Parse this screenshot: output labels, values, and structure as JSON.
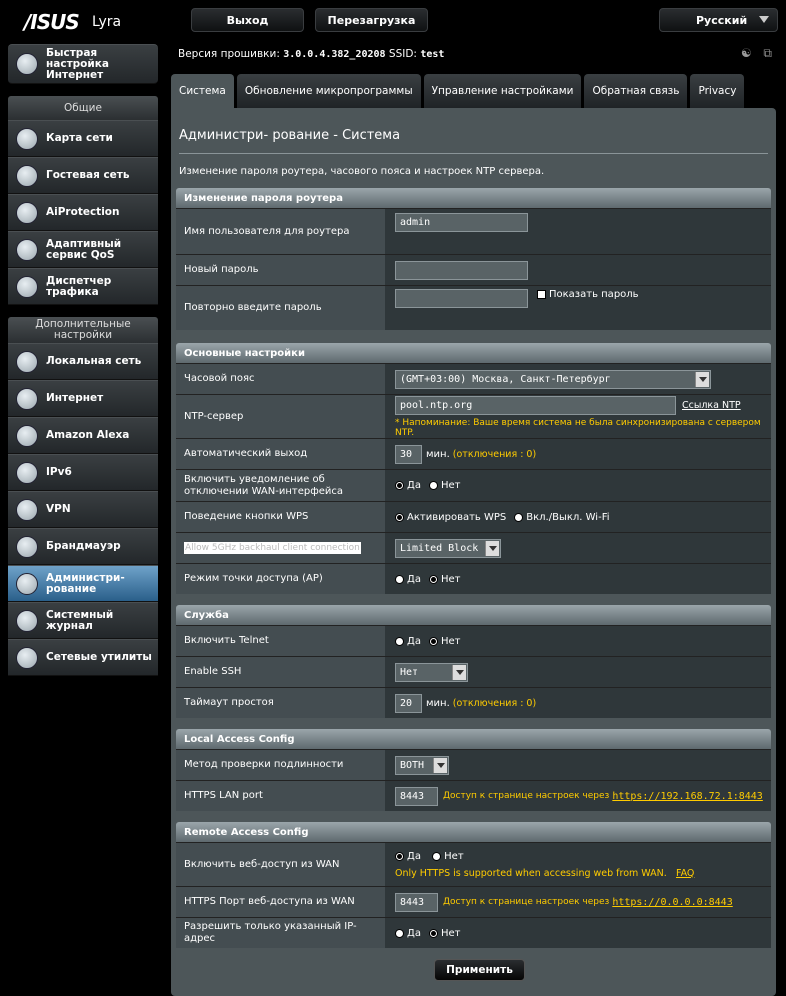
{
  "header": {
    "brand": "/ISUS",
    "model": "Lyra",
    "logout_label": "Выход",
    "reboot_label": "Перезагрузка",
    "language": "Русский"
  },
  "firmware": {
    "label": "Версия прошивки:",
    "version": "3.0.0.4.382_20208",
    "ssid_label": "SSID:",
    "ssid": "test"
  },
  "sidebar": {
    "quick_setup": "Быстрая настройка Интернет",
    "general_head": "Общие",
    "general_items": [
      "Карта сети",
      "Гостевая сеть",
      "AiProtection",
      "Адаптивный сервис QoS",
      "Диспетчер трафика"
    ],
    "advanced_head": "Дополнительные настройки",
    "advanced_items": [
      "Локальная сеть",
      "Интернет",
      "Amazon Alexa",
      "IPv6",
      "VPN",
      "Брандмауэр",
      "Администри- рование",
      "Системный журнал",
      "Сетевые утилиты"
    ]
  },
  "tabs": [
    "Система",
    "Обновление микропрограммы",
    "Управление настройками",
    "Обратная связь",
    "Privacy"
  ],
  "page": {
    "title": "Администри- рование - Система",
    "description": "Изменение пароля роутера, часового пояса и настроек NTP сервера."
  },
  "password": {
    "head": "Изменение пароля роутера",
    "username_label": "Имя пользователя для роутера",
    "username": "admin",
    "new_label": "Новый пароль",
    "repeat_label": "Повторно введите пароль",
    "show_label": "Показать пароль"
  },
  "basic": {
    "head": "Основные настройки",
    "tz_label": "Часовой пояс",
    "tz_value": "(GMT+03:00) Москва, Санкт-Петербург",
    "ntp_label": "NTP-сервер",
    "ntp_value": "pool.ntp.org",
    "ntp_link": "Ссылка NTP",
    "ntp_hint": "* Напоминание: Ваше время система не была синхронизирована с сервером NTP.",
    "logout_label": "Автоматический выход",
    "logout_value": "30",
    "logout_unit": "мин.",
    "logout_hint": "(отключения : 0)",
    "wan_notify_label": "Включить уведомление об отключении WAN-интерфейса",
    "yes": "Да",
    "no": "Нет",
    "wps_label": "Поведение кнопки WPS",
    "wps_opt1": "Активировать WPS",
    "wps_opt2": "Вкл./Выкл. Wi-Fi",
    "backhaul_label": "Allow 5GHz backhaul client connection",
    "backhaul_value": "Limited Block",
    "ap_label": "Режим точки доступа (AP)"
  },
  "service": {
    "head": "Служба",
    "telnet_label": "Включить Telnet",
    "ssh_label": "Enable SSH",
    "ssh_value": "Нет",
    "idle_label": "Таймаут простоя",
    "idle_value": "20",
    "idle_unit": "мин.",
    "idle_hint": "(отключения : 0)"
  },
  "local": {
    "head": "Local Access Config",
    "auth_label": "Метод проверки подлинности",
    "auth_value": "BOTH",
    "https_label": "HTTPS LAN port",
    "https_value": "8443",
    "https_hint": "Доступ к странице настроек через",
    "https_link": "https://192.168.72.1:8443"
  },
  "remote": {
    "head": "Remote Access Config",
    "wan_label": "Включить веб-доступ из WAN",
    "wan_note": "Only HTTPS is supported when accessing web from WAN.",
    "faq": "FAQ",
    "port_label": "HTTPS Порт веб-доступа из WAN",
    "port_value": "8443",
    "port_hint": "Доступ к странице настроек через",
    "port_link": "https://0.0.0.0:8443",
    "ip_label": "Разрешить только указанный IP-адрес"
  },
  "apply_label": "Применить"
}
